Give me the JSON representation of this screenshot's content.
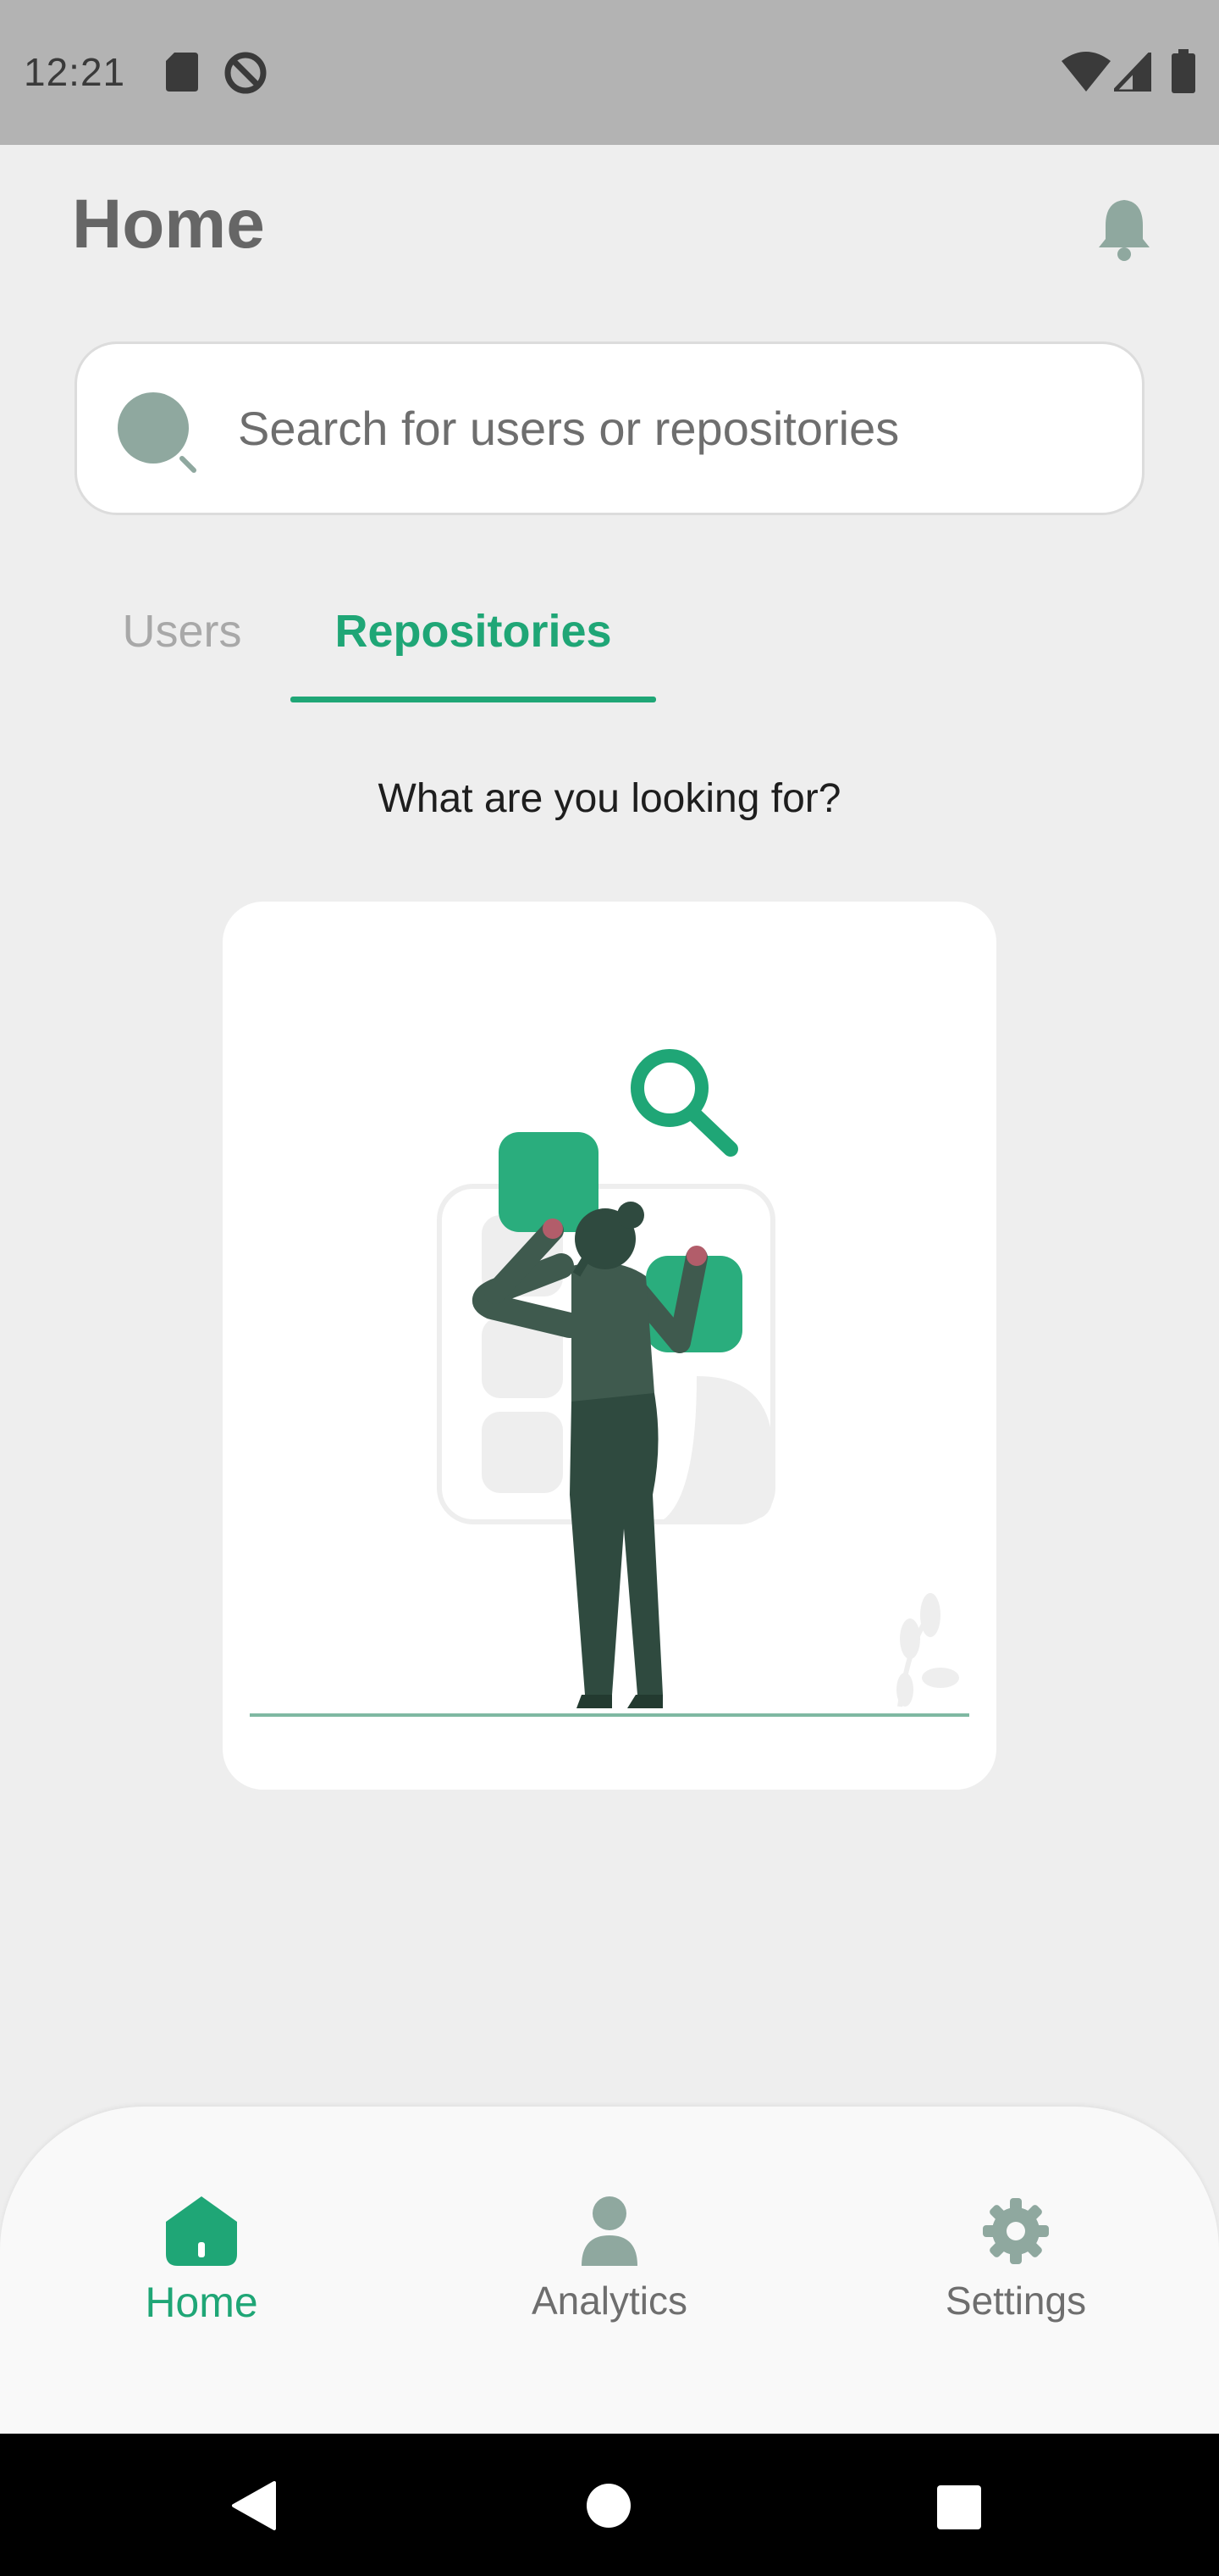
{
  "status_bar": {
    "time": "12:21",
    "icons": [
      "sd-card-icon",
      "do-not-disturb-icon",
      "wifi-icon",
      "signal-icon",
      "battery-icon"
    ]
  },
  "header": {
    "title": "Home",
    "notification_icon": "bell-icon"
  },
  "search": {
    "placeholder": "Search for users or repositories",
    "value": "",
    "icon": "search-icon"
  },
  "tabs": [
    {
      "label": "Users",
      "selected": false
    },
    {
      "label": "Repositories",
      "selected": true
    }
  ],
  "main": {
    "prompt": "What are you looking for?",
    "illustration": "person-searching-illustration"
  },
  "bottom_nav": {
    "items": [
      {
        "label": "Home",
        "icon": "home-icon",
        "active": true
      },
      {
        "label": "Analytics",
        "icon": "person-icon",
        "active": false
      },
      {
        "label": "Settings",
        "icon": "gear-icon",
        "active": false
      }
    ]
  },
  "system_nav": [
    "back-icon",
    "home-circle-icon",
    "recents-icon"
  ],
  "colors": {
    "accent": "#1fa676",
    "icon_muted": "#8fa89f",
    "background": "#eeeeee",
    "status_bar": "#b3b3b3"
  }
}
